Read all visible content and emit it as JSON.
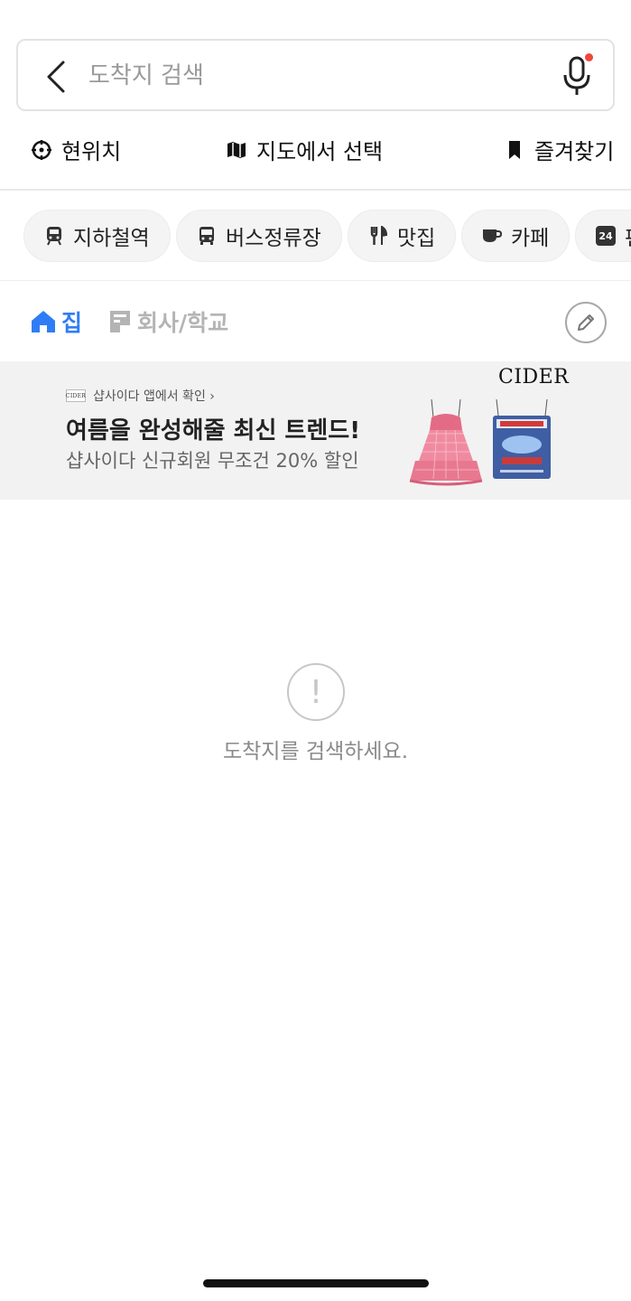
{
  "search": {
    "placeholder": "도착지 검색",
    "back_icon": "chevron-left-icon",
    "mic_icon": "microphone-icon",
    "mic_badge_color": "#f0463c"
  },
  "quick_actions": [
    {
      "label": "현위치",
      "icon": "crosshair-icon"
    },
    {
      "label": "지도에서 선택",
      "icon": "map-icon"
    },
    {
      "label": "즐겨찾기",
      "icon": "bookmark-icon"
    }
  ],
  "categories": [
    {
      "label": "지하철역",
      "icon": "subway-icon"
    },
    {
      "label": "버스정류장",
      "icon": "bus-icon"
    },
    {
      "label": "맛집",
      "icon": "restaurant-icon"
    },
    {
      "label": "카페",
      "icon": "cafe-icon"
    },
    {
      "label": "편",
      "icon": "convenience-24-icon",
      "icon_text": "24"
    }
  ],
  "place_tabs": [
    {
      "label": "집",
      "icon": "home-icon",
      "active": true
    },
    {
      "label": "회사/학교",
      "icon": "building-icon",
      "active": false
    }
  ],
  "edit_icon": "pencil-icon",
  "ad": {
    "source": "샵사이다 앱에서 확인 ›",
    "small_logo": "CIDER",
    "headline": "여름을 완성해줄 최신 트렌드!",
    "subtext": "샵사이다 신규회원 무조건 20% 할인",
    "brand": "CIDER"
  },
  "empty_state": {
    "icon": "exclamation-circle-icon",
    "message": "도착지를 검색하세요."
  },
  "colors": {
    "accent": "#2f7df6",
    "inactive": "#b4b4b4",
    "chip_bg": "#f4f4f4",
    "ad_bg": "#f2f2f2"
  }
}
